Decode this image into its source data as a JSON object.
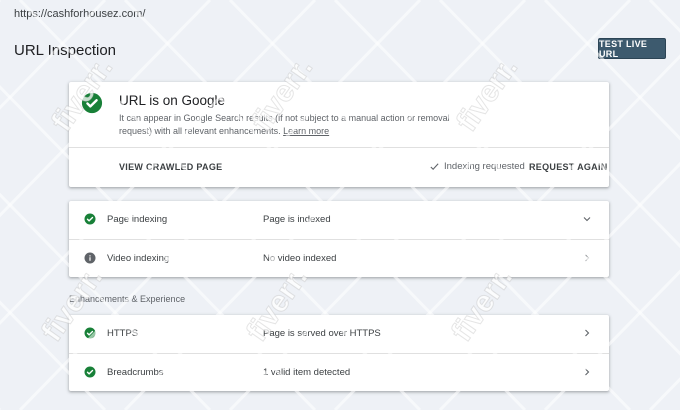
{
  "url_bar": {
    "text": "https://cashforhousez.com/"
  },
  "header": {
    "title": "URL Inspection",
    "test_live_label": "TEST LIVE URL"
  },
  "summary": {
    "headline": "URL is on Google",
    "description": "It can appear in Google Search results (if not subject to a manual action or removal request) with all relevant enhancements.",
    "learn_more": "Learn more",
    "view_crawled_label": "VIEW CRAWLED PAGE",
    "indexing_status": "Indexing requested",
    "request_again_label": "REQUEST AGAIN"
  },
  "coverage_rows": [
    {
      "name": "Page indexing",
      "value": "Page is indexed",
      "status_icon": "check-circle-icon",
      "chevron": "chevron-down-icon"
    },
    {
      "name": "Video indexing",
      "value": "No video indexed",
      "status_icon": "info-icon",
      "chevron": "chevron-right-icon"
    }
  ],
  "section": {
    "label": "Enhancements & Experience"
  },
  "enhancement_rows": [
    {
      "name": "HTTPS",
      "value": "Page is served over HTTPS",
      "status_icon": "check-circle-icon",
      "chevron": "chevron-right-icon"
    },
    {
      "name": "Breadcrumbs",
      "value": "1 valid item detected",
      "status_icon": "check-circle-icon",
      "chevron": "chevron-right-icon"
    }
  ],
  "watermark": {
    "text": "fiverr."
  },
  "colors": {
    "success": "#188038",
    "info": "#5f6368",
    "primary_button": "#3d5a6e",
    "background": "#eef1f6"
  }
}
